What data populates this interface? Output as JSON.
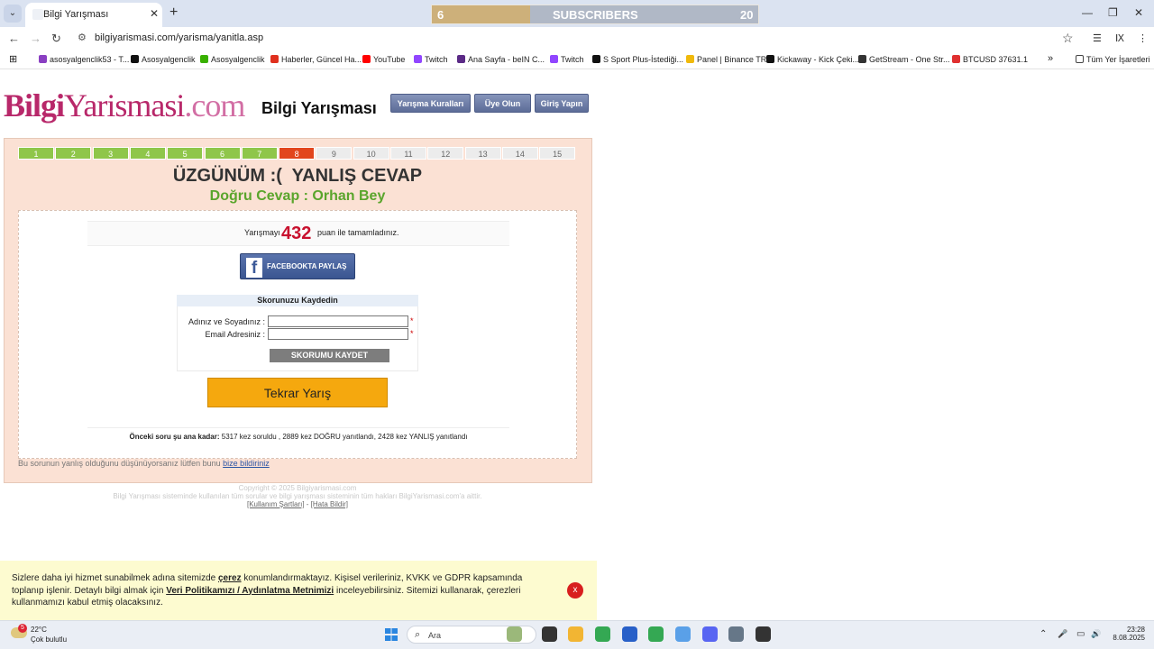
{
  "browser": {
    "tab_title": "Bilgi Yarışması",
    "tab_close": "✕",
    "new_tab": "+",
    "menu_icon": "⌄",
    "url": "bilgiyarismasi.com/yarisma/yanitla.asp",
    "subscriber_widget": {
      "left": "6",
      "label": "SUBSCRIBERS",
      "right": "20",
      "progress_fraction": 0.3
    },
    "window_controls": [
      "—",
      "❐",
      "✕"
    ],
    "nav": {
      "back": "←",
      "forward": "→",
      "reload": "↻",
      "site_info": "⚙",
      "star": "☆"
    },
    "right_icons": [
      "☰",
      "Ⅸ",
      "⋮"
    ],
    "bookmarks": [
      {
        "label": "asosyalgenclik53 - T...",
        "icon_color": "#8a3fc2"
      },
      {
        "label": "Asosyalgenclik",
        "icon_color": "#111111"
      },
      {
        "label": "Asosyalgenclik",
        "icon_color": "#38b000"
      },
      {
        "label": "Haberler, Güncel Ha...",
        "icon_color": "#e0301e"
      },
      {
        "label": "YouTube",
        "icon_color": "#ff0000"
      },
      {
        "label": "Twitch",
        "icon_color": "#9146ff"
      },
      {
        "label": "Ana Sayfa - beIN C...",
        "icon_color": "#5b2a86"
      },
      {
        "label": "Twitch",
        "icon_color": "#9146ff"
      },
      {
        "label": "S Sport Plus-İstediği...",
        "icon_color": "#111111"
      },
      {
        "label": "Panel | Binance TR",
        "icon_color": "#f0b90b"
      },
      {
        "label": "Kickaway - Kick Çeki...",
        "icon_color": "#111111"
      },
      {
        "label": "GetStream - One Str...",
        "icon_color": "#333333"
      },
      {
        "label": "BTCUSD 37631.1",
        "icon_color": "#e03030"
      }
    ],
    "bookmarks_more": "»",
    "all_bookmarks": "Tüm Yer İşaretleri",
    "apps_icon": "⊞"
  },
  "site": {
    "logo": {
      "part1": "Bilgi",
      "part2": "Yarismasi",
      "part3": ".com"
    },
    "title": "Bilgi Yarışması",
    "nav_buttons": [
      "Yarışma Kuralları",
      "Üye Olun",
      "Giriş Yapın"
    ]
  },
  "quiz": {
    "steps": [
      {
        "n": "1",
        "state": "ok"
      },
      {
        "n": "2",
        "state": "ok"
      },
      {
        "n": "3",
        "state": "ok"
      },
      {
        "n": "4",
        "state": "ok"
      },
      {
        "n": "5",
        "state": "ok"
      },
      {
        "n": "6",
        "state": "ok"
      },
      {
        "n": "7",
        "state": "ok"
      },
      {
        "n": "8",
        "state": "bad"
      },
      {
        "n": "9",
        "state": "none"
      },
      {
        "n": "10",
        "state": "none"
      },
      {
        "n": "11",
        "state": "none"
      },
      {
        "n": "12",
        "state": "none"
      },
      {
        "n": "13",
        "state": "none"
      },
      {
        "n": "14",
        "state": "none"
      },
      {
        "n": "15",
        "state": "none"
      }
    ],
    "result_heading": "ÜZGÜNÜM :(  YANLIŞ CEVAP",
    "correct_answer": "Doğru Cevap : Orhan Bey",
    "score_pre": "Yarışmayı",
    "score": "432",
    "score_post": "puan ile tamamladınız.",
    "facebook_label": "FACEBOOKTA PAYLAŞ",
    "facebook_f": "f",
    "save": {
      "heading": "Skorunuzu Kaydedin",
      "name_label": "Adınız ve Soyadınız :",
      "email_label": "Email Adresiniz :",
      "name_value": "",
      "email_value": "",
      "required": "*",
      "button": "SKORUMU KAYDET"
    },
    "retry_button": "Tekrar Yarış",
    "stats_bold": "Önceki soru şu ana kadar:",
    "stats_text": " 5317 kez soruldu , 2889 kez DOĞRU yanıtlandı, 2428 kez YANLIŞ yanıtlandı",
    "report_text": "Bu sorunun yanlış olduğunu düşünüyorsanız lütfen bunu ",
    "report_link": "bize bildiriniz"
  },
  "footer": {
    "copyright": "Copyright © 2025 Bilgiyarismasi.com",
    "rights": "Bilgi Yarışması sisteminde kullanılan tüm sorular ve bilgi yarışması sisteminin tüm hakları BilgiYarismasi.com'a aittir.",
    "link1": "[Kullanım Şartları]",
    "separator": " - ",
    "link2": "[Hata Bildir]"
  },
  "cookie": {
    "text1": "Sizlere daha iyi hizmet sunabilmek adına sitemizde ",
    "link1": "çerez",
    "text2": " konumlandırmaktayız. Kişisel verileriniz, KVKK ve GDPR kapsamında toplanıp işlenir. Detaylı bilgi almak için ",
    "link2": "Veri Politikamızı / Aydınlatma Metnimizi",
    "text3": " inceleyebilirsiniz. Sitemizi kullanarak, çerezleri kullanmamızı kabul etmiş olacaksınız.",
    "close": "x"
  },
  "taskbar": {
    "weather_badge": "5",
    "temperature": "22°C",
    "condition": "Çok bulutlu",
    "search_placeholder": "Ara",
    "search_icon": "⌕",
    "time": "23:28",
    "date": "8.08.2025",
    "tray_icons": [
      "⌃",
      "🎤",
      "▭",
      "🔊"
    ],
    "apps": [
      {
        "name": "file-explorer",
        "color": "#f2c94c"
      },
      {
        "name": "widgets",
        "color": "#9bb87a"
      },
      {
        "name": "task-view",
        "color": "#333333"
      },
      {
        "name": "folder",
        "color": "#f2b533"
      },
      {
        "name": "chrome",
        "color": "#34a853"
      },
      {
        "name": "store",
        "color": "#2860c8"
      },
      {
        "name": "chrome-profile",
        "color": "#34a853"
      },
      {
        "name": "vpn",
        "color": "#5aa0e8"
      },
      {
        "name": "discord",
        "color": "#5865f2"
      },
      {
        "name": "settings",
        "color": "#667788"
      },
      {
        "name": "obs",
        "color": "#333333"
      }
    ]
  }
}
